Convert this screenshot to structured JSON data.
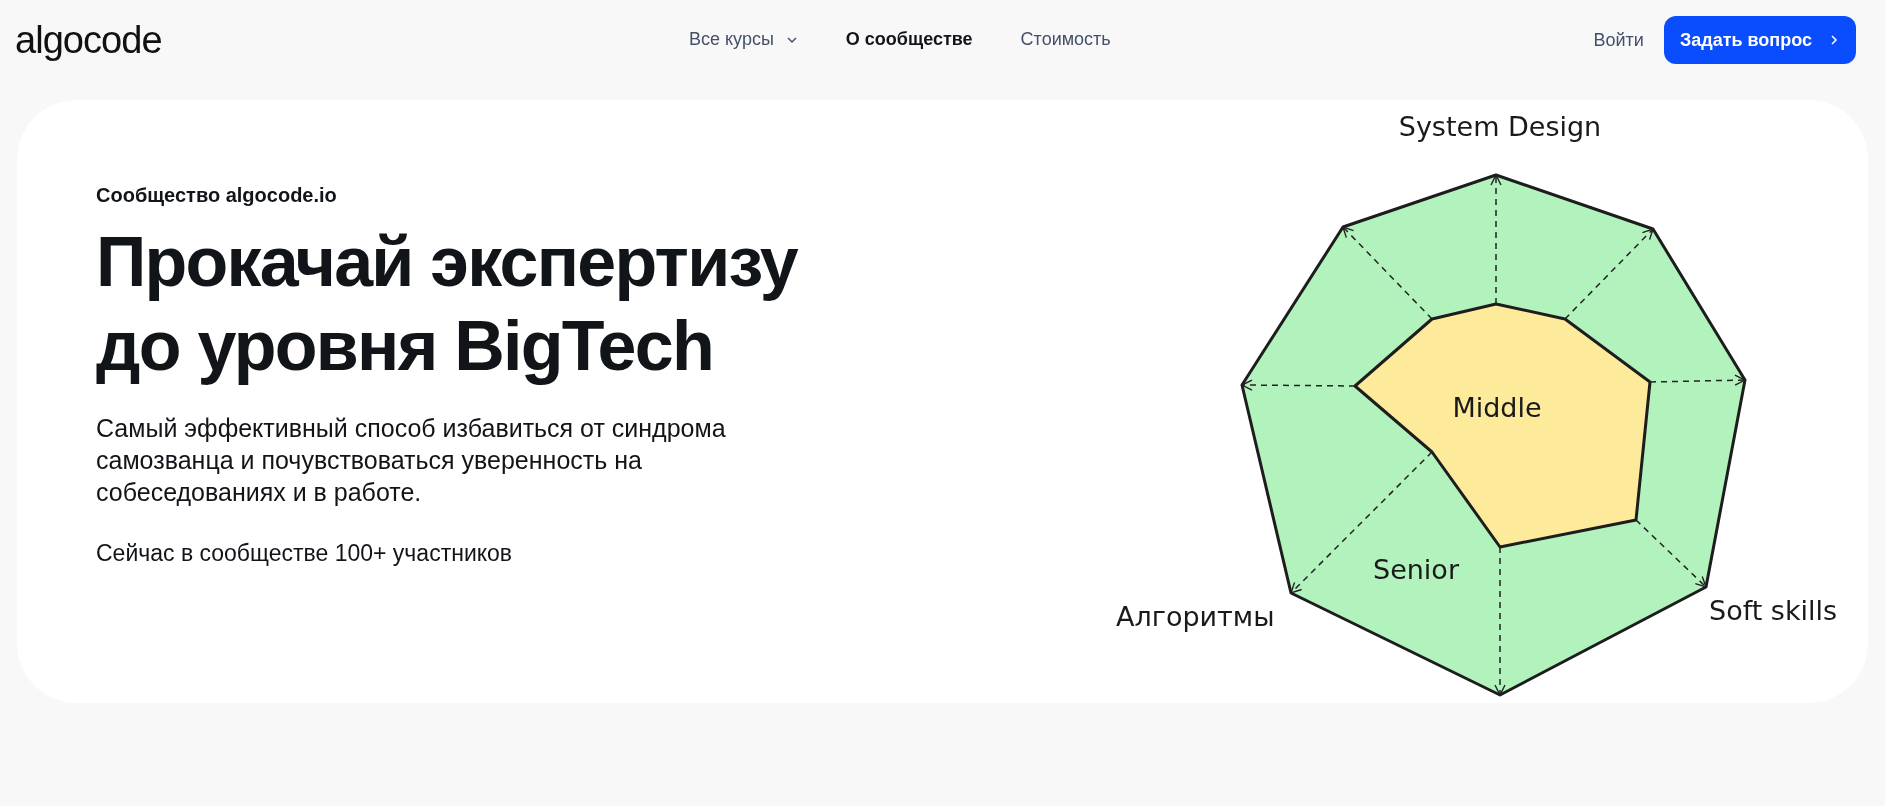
{
  "header": {
    "logo": "algocode",
    "nav": [
      {
        "label": "Все курсы",
        "kind": "dropdown",
        "selected": false
      },
      {
        "label": "О сообществе",
        "kind": "link",
        "selected": true
      },
      {
        "label": "Стоимость",
        "kind": "link",
        "selected": false
      }
    ],
    "login": "Войти",
    "cta": "Задать вопрос"
  },
  "hero": {
    "eyebrow": "Сообщество algocode.io",
    "title": [
      "Прокачай экспертизу",
      "до уровня BigTech"
    ],
    "description": "Самый эффективный способ избавиться от синдрома самозванца и почувствоваться уверенность на собеседованиях и в работе.",
    "members": "Сейчас в сообществе 100+ участников"
  },
  "diagram": {
    "axes": [
      {
        "label": "System Design"
      },
      {
        "label": "Soft skills"
      },
      {
        "label": "Алгоритмы"
      }
    ],
    "levels": [
      {
        "label": "Middle"
      },
      {
        "label": "Senior"
      }
    ]
  }
}
